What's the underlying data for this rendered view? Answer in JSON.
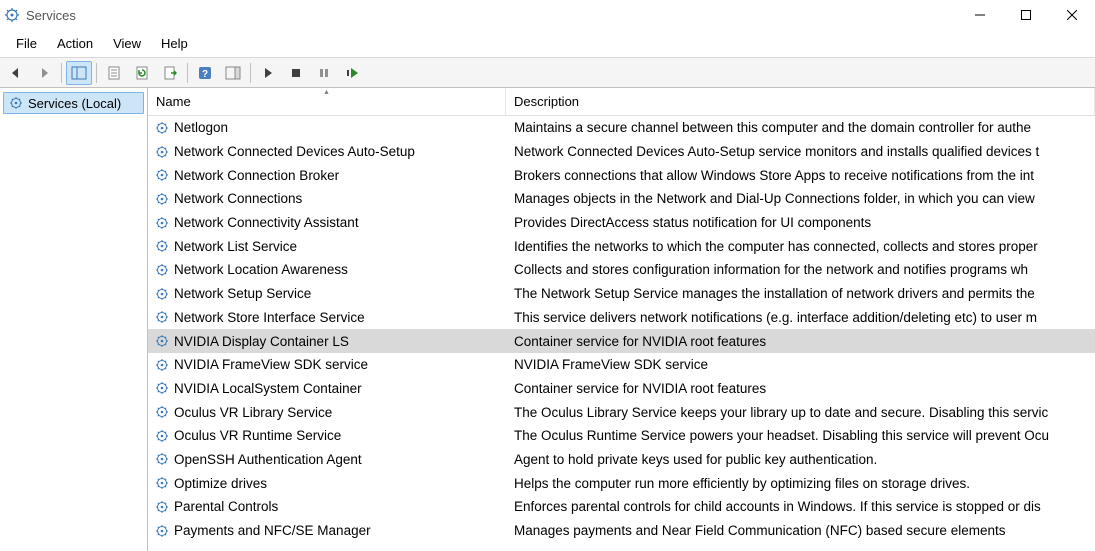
{
  "window": {
    "title": "Services"
  },
  "menus": {
    "file": "File",
    "action": "Action",
    "view": "View",
    "help": "Help"
  },
  "tree": {
    "root": "Services (Local)"
  },
  "columns": {
    "name": "Name",
    "description": "Description"
  },
  "selected_index": 9,
  "services": [
    {
      "name": "Netlogon",
      "desc": "Maintains a secure channel between this computer and the domain controller for authe"
    },
    {
      "name": "Network Connected Devices Auto-Setup",
      "desc": "Network Connected Devices Auto-Setup service monitors and installs qualified devices t"
    },
    {
      "name": "Network Connection Broker",
      "desc": "Brokers connections that allow Windows Store Apps to receive notifications from the int"
    },
    {
      "name": "Network Connections",
      "desc": "Manages objects in the Network and Dial-Up Connections folder, in which you can view"
    },
    {
      "name": "Network Connectivity Assistant",
      "desc": "Provides DirectAccess status notification for UI components"
    },
    {
      "name": "Network List Service",
      "desc": "Identifies the networks to which the computer has connected, collects and stores proper"
    },
    {
      "name": "Network Location Awareness",
      "desc": "Collects and stores configuration information for the network and notifies programs wh"
    },
    {
      "name": "Network Setup Service",
      "desc": "The Network Setup Service manages the installation of network drivers and permits the"
    },
    {
      "name": "Network Store Interface Service",
      "desc": "This service delivers network notifications (e.g. interface addition/deleting etc) to user m"
    },
    {
      "name": "NVIDIA Display Container LS",
      "desc": "Container service for NVIDIA root features"
    },
    {
      "name": "NVIDIA FrameView SDK service",
      "desc": "NVIDIA FrameView SDK service"
    },
    {
      "name": "NVIDIA LocalSystem Container",
      "desc": "Container service for NVIDIA root features"
    },
    {
      "name": "Oculus VR Library Service",
      "desc": "The Oculus Library Service keeps your library up to date and secure. Disabling this servic"
    },
    {
      "name": "Oculus VR Runtime Service",
      "desc": "The Oculus Runtime Service powers your headset. Disabling this service will prevent Ocu"
    },
    {
      "name": "OpenSSH Authentication Agent",
      "desc": "Agent to hold private keys used for public key authentication."
    },
    {
      "name": "Optimize drives",
      "desc": "Helps the computer run more efficiently by optimizing files on storage drives."
    },
    {
      "name": "Parental Controls",
      "desc": "Enforces parental controls for child accounts in Windows. If this service is stopped or dis"
    },
    {
      "name": "Payments and NFC/SE Manager",
      "desc": "Manages payments and Near Field Communication (NFC) based secure elements"
    }
  ]
}
